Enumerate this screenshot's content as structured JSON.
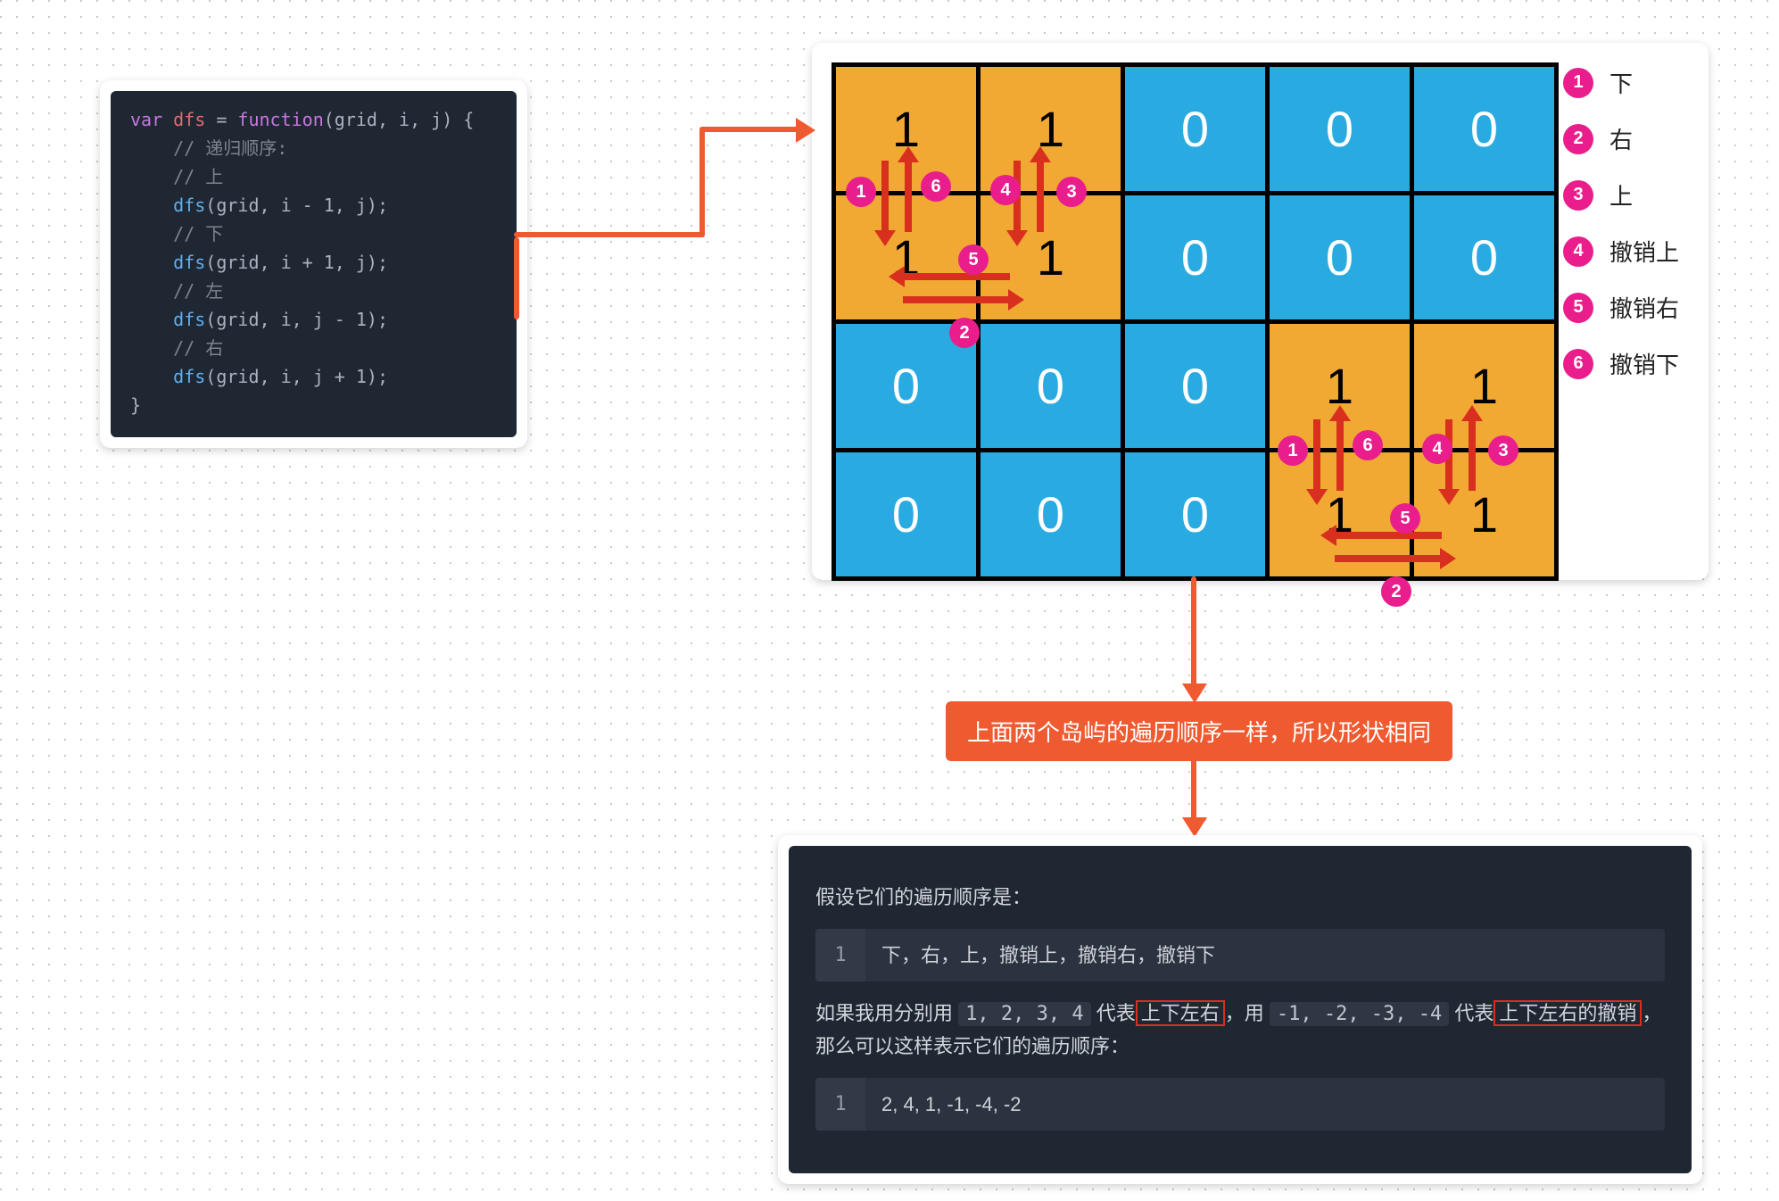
{
  "code1": {
    "l1_var": "var",
    "l1_dfs": "dfs",
    "l1_eq": " = ",
    "l1_fn": "function",
    "l1_args": "(grid, i, j) {",
    "l2": "    // 递归顺序:",
    "l3": "    // 上",
    "l4_call": "    dfs",
    "l4_args": "(grid, i - 1, j);",
    "l5": "    // 下",
    "l6_call": "    dfs",
    "l6_args": "(grid, i + 1, j);",
    "l7": "    // 左",
    "l8_call": "    dfs",
    "l8_args": "(grid, i, j - 1);",
    "l9": "    // 右",
    "l10_call": "    dfs",
    "l10_args": "(grid, i, j + 1);",
    "l11": "}"
  },
  "grid": {
    "rows": [
      [
        1,
        1,
        0,
        0,
        0
      ],
      [
        1,
        1,
        0,
        0,
        0
      ],
      [
        0,
        0,
        0,
        1,
        1
      ],
      [
        0,
        0,
        0,
        1,
        1
      ]
    ]
  },
  "legend": [
    {
      "n": "1",
      "label": "下"
    },
    {
      "n": "2",
      "label": "右"
    },
    {
      "n": "3",
      "label": "上"
    },
    {
      "n": "4",
      "label": "撤销上"
    },
    {
      "n": "5",
      "label": "撤销右"
    },
    {
      "n": "6",
      "label": "撤销下"
    }
  ],
  "badges": {
    "b1": "1",
    "b2": "2",
    "b3": "3",
    "b4": "4",
    "b5": "5",
    "b6": "6"
  },
  "callout1": "上面两个岛屿的遍历顺序一样，所以形状相同",
  "bottom": {
    "p1": "假设它们的遍历顺序是：",
    "ln1_num": "1",
    "ln1_txt": "下，右，上，撤销上，撤销右，撤销下",
    "p2a": "如果我用分别用 ",
    "p2_nums1": "1, 2, 3, 4",
    "p2b": " 代表",
    "p2_box1": "上下左右",
    "p2c": "，用 ",
    "p2_nums2": "-1, -2, -3, -4",
    "p2d": " 代表",
    "p2_box2": "上下左右的撤销",
    "p2e": "，那么可以这样表示它们的遍历顺序：",
    "ln2_num": "1",
    "ln2_txt": "2, 4, 1, -1, -4, -2"
  }
}
